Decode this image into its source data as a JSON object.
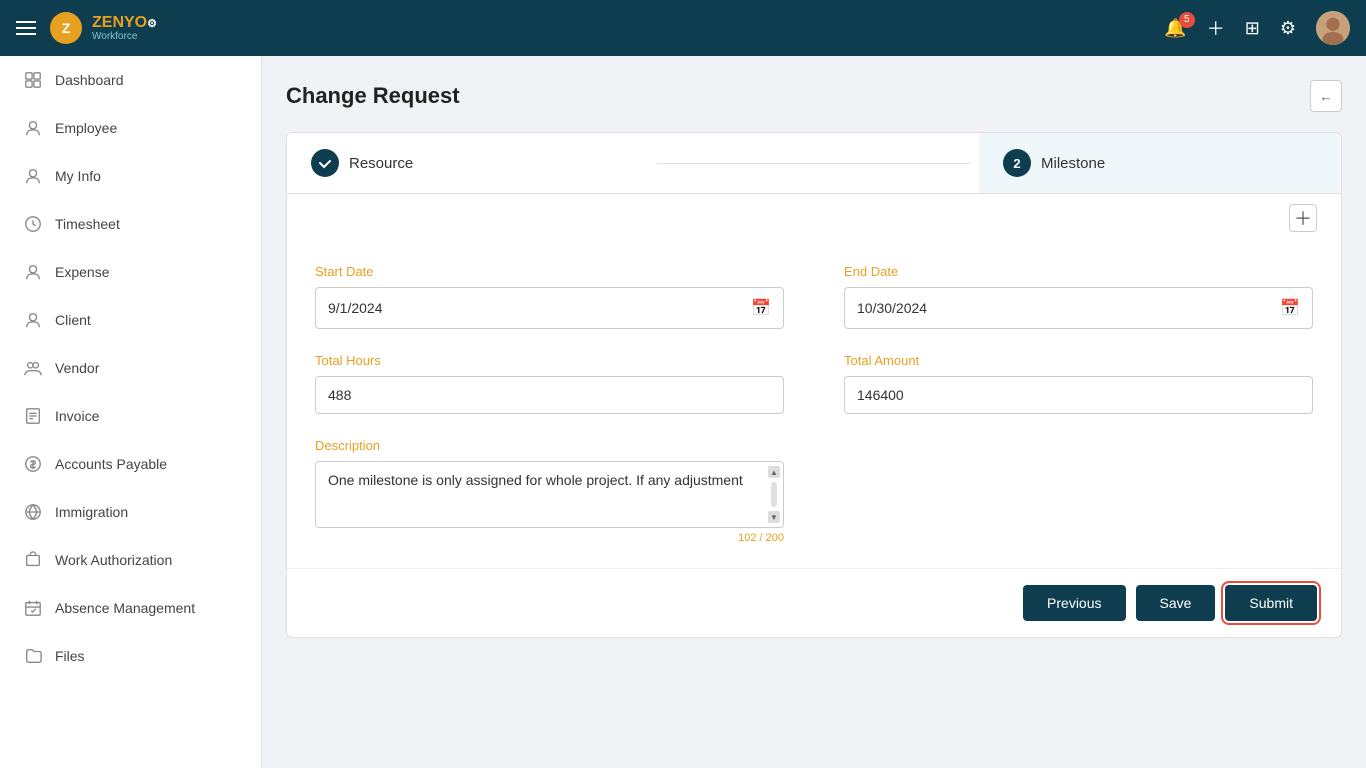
{
  "app": {
    "name": "ZENYO",
    "sub": "Workforce",
    "notification_count": "5"
  },
  "page": {
    "title": "Change Request",
    "back_label": "←"
  },
  "steps": [
    {
      "id": 1,
      "label": "Resource",
      "icon": "✎",
      "state": "completed"
    },
    {
      "id": 2,
      "label": "Milestone",
      "state": "active"
    }
  ],
  "form": {
    "start_date_label": "Start Date",
    "start_date_value": "9/1/2024",
    "end_date_label": "End Date",
    "end_date_value": "10/30/2024",
    "total_hours_label": "Total Hours",
    "total_hours_value": "488",
    "total_amount_label": "Total Amount",
    "total_amount_value": "146400",
    "description_label": "Description",
    "description_value": "One milestone is only assigned for whole project. If any adjustment",
    "char_count": "102 / 200"
  },
  "actions": {
    "previous_label": "Previous",
    "save_label": "Save",
    "submit_label": "Submit"
  },
  "sidebar": {
    "items": [
      {
        "id": "dashboard",
        "label": "Dashboard",
        "icon": "grid"
      },
      {
        "id": "employee",
        "label": "Employee",
        "icon": "person"
      },
      {
        "id": "myinfo",
        "label": "My Info",
        "icon": "person-circle"
      },
      {
        "id": "timesheet",
        "label": "Timesheet",
        "icon": "clock"
      },
      {
        "id": "expense",
        "label": "Expense",
        "icon": "person-badge"
      },
      {
        "id": "client",
        "label": "Client",
        "icon": "person-lines"
      },
      {
        "id": "vendor",
        "label": "Vendor",
        "icon": "people"
      },
      {
        "id": "invoice",
        "label": "Invoice",
        "icon": "receipt"
      },
      {
        "id": "accounts-payable",
        "label": "Accounts Payable",
        "icon": "currency"
      },
      {
        "id": "immigration",
        "label": "Immigration",
        "icon": "globe"
      },
      {
        "id": "work-authorization",
        "label": "Work Authorization",
        "icon": "briefcase"
      },
      {
        "id": "absence-management",
        "label": "Absence Management",
        "icon": "calendar-x"
      },
      {
        "id": "files",
        "label": "Files",
        "icon": "folder"
      }
    ]
  }
}
